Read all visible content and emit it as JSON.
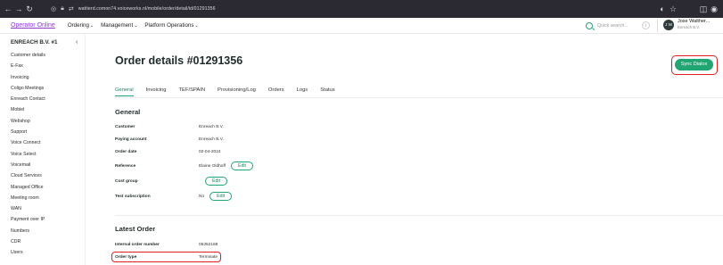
{
  "browser": {
    "url": "wattierd.comon74.voiceworks.nl/mobile/order/detail/id/01291356"
  },
  "header": {
    "brand": "Operator Online",
    "nav": [
      {
        "label": "Ordering"
      },
      {
        "label": "Management"
      },
      {
        "label": "Platform Operations"
      }
    ],
    "search_placeholder": "Quick search...",
    "search_shortcut": "/",
    "user": {
      "initials": "J W",
      "name": "Jose Walther...",
      "org": "Enreach B.V."
    }
  },
  "sidebar": {
    "title": "ENREACH B.V. #1",
    "items": [
      {
        "label": "Customer details"
      },
      {
        "label": "E-Fax"
      },
      {
        "label": "Invoicing"
      },
      {
        "label": "Coligo Meetings"
      },
      {
        "label": "Enreach Contact"
      },
      {
        "label": "Mobiel"
      },
      {
        "label": "Webshop"
      },
      {
        "label": "Support"
      },
      {
        "label": "Voice Connect"
      },
      {
        "label": "Voice Select"
      },
      {
        "label": "Voicemail"
      },
      {
        "label": "Cloud Services"
      },
      {
        "label": "Managed Office"
      },
      {
        "label": "Meeting room"
      },
      {
        "label": "WAN"
      },
      {
        "label": "Payment over IP"
      },
      {
        "label": "Numbers"
      },
      {
        "label": "CDR"
      },
      {
        "label": "Users"
      }
    ]
  },
  "main": {
    "title": "Order details #01291356",
    "sync_button": "Sync Dialox",
    "tabs": [
      {
        "label": "General",
        "active": true
      },
      {
        "label": "Invoicing"
      },
      {
        "label": "TEF/SPAIN"
      },
      {
        "label": "Provisioning/Log"
      },
      {
        "label": "Orders"
      },
      {
        "label": "Logs"
      },
      {
        "label": "Status"
      }
    ],
    "general": {
      "title": "General",
      "customer_label": "Customer",
      "customer_value": "Enreach B.V.",
      "paying_label": "Paying account",
      "paying_value": "Enreach B.V.",
      "date_label": "Order date",
      "date_value": "02-04-2024",
      "reference_label": "Reference",
      "reference_value": "Elaine Oldhoff",
      "costgroup_label": "Cost group",
      "costgroup_value": "",
      "test_label": "Test subscription",
      "test_value": "No",
      "edit_label": "Edit"
    },
    "latest": {
      "title": "Latest Order",
      "internal_label": "Internal order number",
      "internal_value": "05352188",
      "type_label": "Order type",
      "type_value": "Terminate"
    }
  },
  "colors": {
    "accent": "#1fa672",
    "highlight": "#e02020",
    "brand": "#8a3ccf"
  }
}
